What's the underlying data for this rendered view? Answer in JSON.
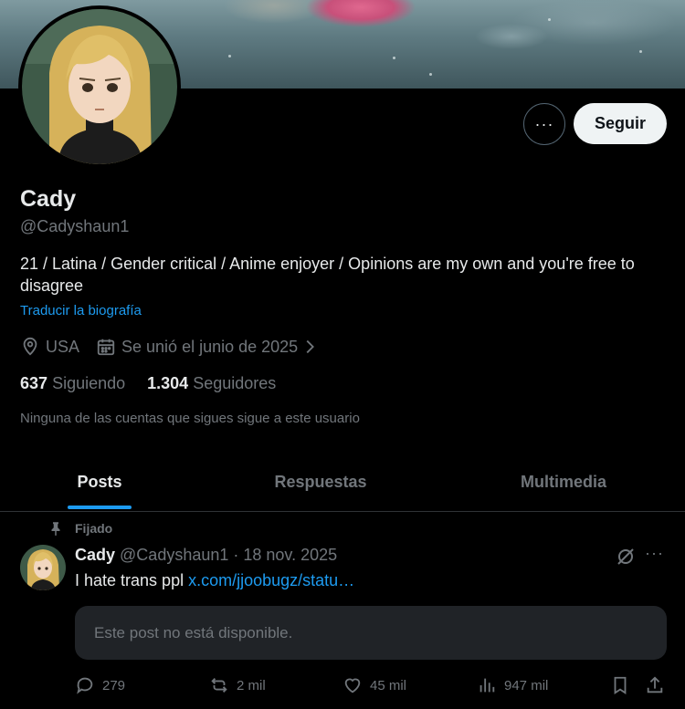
{
  "profile": {
    "name": "Cady",
    "handle": "@Cadyshaun1",
    "bio": "21 / Latina / Gender critical / Anime enjoyer / Opinions are my own and you're free to disagree",
    "translate_link": "Traducir la biografía",
    "location": "USA",
    "joined": "Se unió el junio de 2025",
    "following_count": "637",
    "following_label": "Siguiendo",
    "followers_count": "1.304",
    "followers_label": "Seguidores",
    "mutuals_notice": "Ninguna de las cuentas que sigues sigue a este usuario"
  },
  "header": {
    "follow_label": "Seguir",
    "more_label": "···"
  },
  "tabs": [
    {
      "label": "Posts",
      "active": true
    },
    {
      "label": "Respuestas",
      "active": false
    },
    {
      "label": "Multimedia",
      "active": false
    }
  ],
  "post": {
    "pinned_label": "Fijado",
    "author": "Cady",
    "meta": "@Cadyshaun1 · 18 nov. 2025",
    "text": "I hate trans ppl",
    "link": "x.com/jjoobugz/statu…",
    "unavailable": "Este post no está disponible.",
    "more_label": "···",
    "replies": "279",
    "reposts": "2 mil",
    "likes": "45 mil",
    "views": "947 mil"
  },
  "colors": {
    "background": "#000000",
    "text": "#e7e9ea",
    "muted": "#71767b",
    "accent": "#1d9bf0",
    "follow_button": "#eff3f4"
  },
  "icons": {
    "location": "location-pin-icon",
    "calendar": "calendar-icon",
    "chevron": "chevron-right-icon",
    "pin": "pin-icon",
    "grok": "grok-icon",
    "reply": "reply-icon",
    "repost": "repost-icon",
    "like": "heart-icon",
    "views": "views-chart-icon",
    "bookmark": "bookmark-icon",
    "share": "share-icon"
  }
}
